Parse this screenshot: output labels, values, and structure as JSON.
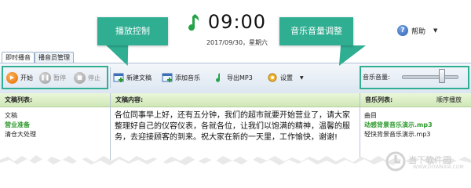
{
  "header": {
    "clock": "09:00",
    "date": "2017/09/30，星期六",
    "help_label": "帮助"
  },
  "callouts": {
    "playback": "播放控制",
    "volume": "音乐音量调整"
  },
  "tabs": [
    {
      "label": "即时播音",
      "active": true
    },
    {
      "label": "播音员管理",
      "active": false
    }
  ],
  "toolbar": {
    "start": "开始",
    "pause": "暂停",
    "stop": "停止",
    "new_script": "新建文稿",
    "add_music": "添加音乐",
    "export_mp3": "导出MP3",
    "settings": "设置",
    "volume_label": "音乐音量:",
    "volume_level": 0.72
  },
  "panels": {
    "script_list": {
      "title": "文稿列表:",
      "column": "文稿",
      "items": [
        {
          "label": "营业准备",
          "selected": true
        },
        {
          "label": "清仓大处理",
          "selected": false
        }
      ]
    },
    "script_content": {
      "title": "文稿内容:",
      "text": "各位同事早上好，还有五分钟，我们的超市就要开始营业了，请大家整理好自己的仪容仪表，各就各位，让我们以饱满的精神，温馨的服务，去迎接顾客的到来。祝大家在新的一天里，工作愉快，谢谢!"
    },
    "music_list": {
      "title": "音乐列表:",
      "order": "顺序播放",
      "column": "曲目",
      "items": [
        {
          "label": "动感背景音乐演示.mp3",
          "selected": true
        },
        {
          "label": "轻快背景音乐演示.mp3",
          "selected": false
        }
      ]
    }
  },
  "watermark": {
    "text": "当下软件园",
    "sub": "WWW.DOWNXIA.COM"
  },
  "colors": {
    "callout": "#2fae92",
    "selected_text": "#2f9a2f",
    "play_button": "#e06a00"
  }
}
